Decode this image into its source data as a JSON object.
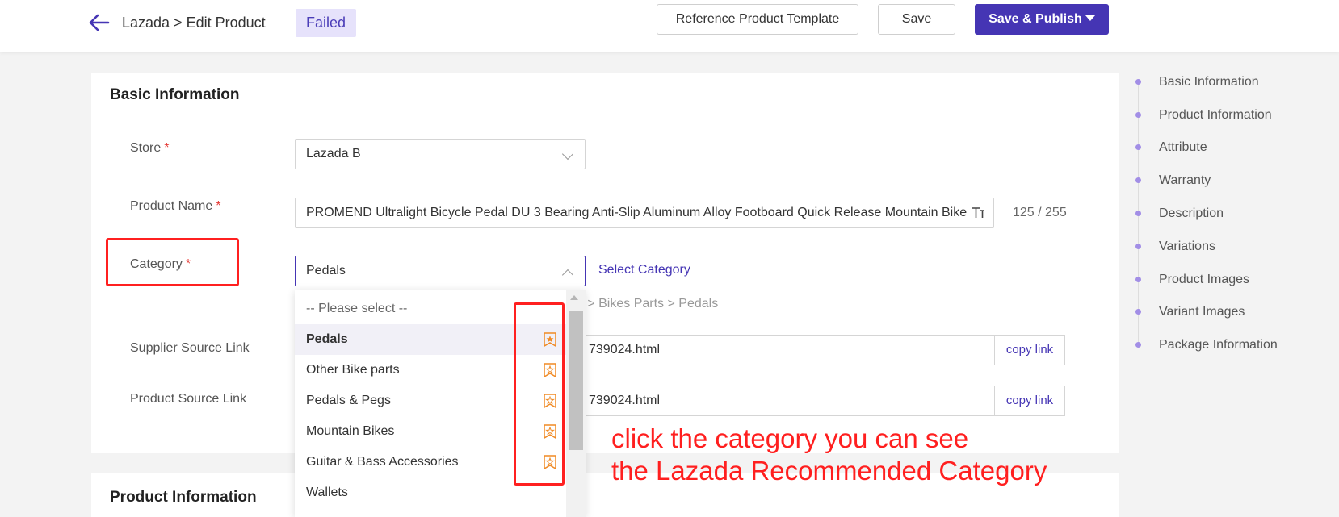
{
  "header": {
    "breadcrumb": "Lazada > Edit Product",
    "status": "Failed",
    "buttons": {
      "reference": "Reference Product Template",
      "save": "Save",
      "publish": "Save & Publish"
    }
  },
  "basic_info": {
    "title": "Basic Information",
    "store": {
      "label": "Store",
      "required_mark": "*",
      "value": "Lazada B"
    },
    "product_name": {
      "label": "Product Name",
      "required_mark": "*",
      "value": "PROMEND Ultralight Bicycle Pedal DU 3 Bearing Anti-Slip Aluminum Alloy Footboard Quick Release Mountain Bike",
      "counter": "125 / 255"
    },
    "category": {
      "label": "Category",
      "required_mark": "*",
      "value": "Pedals",
      "select_link": "Select Category",
      "path": "g > Bikes Parts > Pedals"
    },
    "supplier_source_link": {
      "label": "Supplier Source Link",
      "value": "739024.html",
      "copy": "copy link"
    },
    "product_source_link": {
      "label": "Product Source Link",
      "value": "739024.html",
      "copy": "copy link"
    }
  },
  "dropdown": {
    "placeholder": "-- Please select --",
    "items": [
      {
        "label": "Pedals",
        "selected": true,
        "recommended": true
      },
      {
        "label": "Other Bike parts",
        "recommended": true
      },
      {
        "label": "Pedals & Pegs",
        "recommended": true
      },
      {
        "label": "Mountain Bikes",
        "recommended": true
      },
      {
        "label": "Guitar & Bass Accessories",
        "recommended": true
      },
      {
        "label": "Wallets",
        "recommended": false
      }
    ]
  },
  "product_info": {
    "title": "Product Information"
  },
  "toc": [
    "Basic Information",
    "Product Information",
    "Attribute",
    "Warranty",
    "Description",
    "Variations",
    "Product Images",
    "Variant Images",
    "Package Information"
  ],
  "annotation": {
    "line1": "click the category you can see",
    "line2": "the Lazada Recommended Category"
  },
  "colors": {
    "accent": "#4535b4",
    "recommended_icon": "#f08a24",
    "highlight": "#ff2020",
    "toc_dot": "#a28ee6"
  },
  "icons": {
    "back": "arrow-left-icon",
    "select": "chevron-down-icon",
    "select_open": "chevron-up-icon",
    "translate": "translate-icon",
    "recommended": "recommended-badge-icon",
    "publish_caret": "caret-down-icon"
  }
}
